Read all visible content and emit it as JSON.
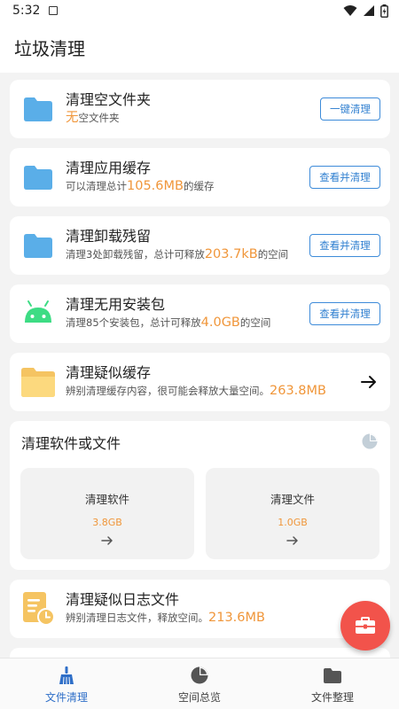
{
  "status_bar": {
    "time": "5:32"
  },
  "app_bar": {
    "title": "垃圾清理"
  },
  "cards": [
    {
      "title": "清理空文件夹",
      "highlight": "无",
      "suffix": "空文件夹",
      "button": "一键清理",
      "icon": "folder-icon"
    },
    {
      "title": "清理应用缓存",
      "prefix": "可以清理总计",
      "highlight": "105.6MB",
      "suffix": "的缓存",
      "button": "查看并清理",
      "icon": "folder-icon"
    },
    {
      "title": "清理卸载残留",
      "prefix": "清理3处卸载残留，总计可释放",
      "highlight": "203.7kB",
      "suffix": "的空间",
      "button": "查看并清理",
      "icon": "folder-icon"
    },
    {
      "title": "清理无用安装包",
      "prefix": "清理85个安装包，总计可释放",
      "highlight": "4.0GB",
      "suffix": "的空间",
      "button": "查看并清理",
      "icon": "android-icon"
    },
    {
      "title": "清理疑似缓存",
      "prefix": "辨别清理缓存内容，很可能会释放大量空间。",
      "highlight": "263.8MB",
      "icon": "folder-open-icon"
    }
  ],
  "software_section": {
    "title": "清理软件或文件",
    "tiles": [
      {
        "label": "清理软件",
        "value": "3.8GB"
      },
      {
        "label": "清理文件",
        "value": "1.0GB"
      }
    ]
  },
  "log_card": {
    "title": "清理疑似日志文件",
    "prefix": "辨别清理日志文件，释放空间。",
    "highlight": "213.6MB"
  },
  "bottom_nav": [
    {
      "label": "文件清理",
      "active": true
    },
    {
      "label": "空间总览",
      "active": false
    },
    {
      "label": "文件整理",
      "active": false
    }
  ],
  "colors": {
    "accent": "#2f6fc8",
    "highlight": "#f0963a",
    "fab": "#f2534b",
    "folder": "#5aaee8",
    "android": "#3ddc84"
  }
}
